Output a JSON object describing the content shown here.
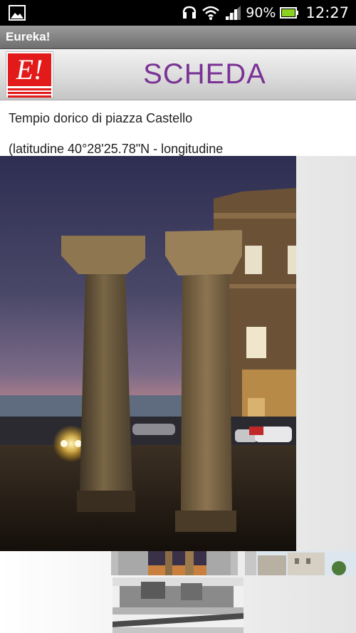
{
  "status_bar": {
    "battery_percent": "90%",
    "time": "12:27",
    "icons": [
      "gallery-icon",
      "headset-icon",
      "wifi-icon",
      "signal-icon",
      "battery-icon"
    ]
  },
  "app": {
    "title": "Eureka!"
  },
  "header": {
    "logo_text": "E!",
    "title": "SCHEDA",
    "title_color": "#7a3394",
    "logo_color": "#e21a1a"
  },
  "detail": {
    "place_name": "Tempio dorico di piazza Castello",
    "coordinates": "(latitudine 40°28'25.78\"N - longitudine"
  },
  "gallery": {
    "main_image": "temple-columns-photo",
    "thumbnails": [
      "thumbnail-temple",
      "thumbnail-street",
      "thumbnail-castle-bw"
    ]
  }
}
